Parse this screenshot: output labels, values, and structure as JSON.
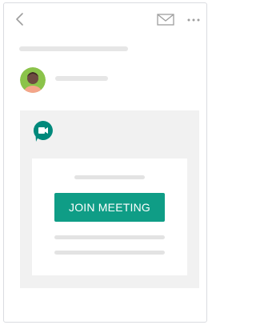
{
  "toolbar": {
    "back_icon": "chevron-left-icon",
    "mail_icon": "envelope-icon",
    "more_icon": "more-horizontal-icon"
  },
  "sender": {
    "avatar_icon": "person-avatar"
  },
  "event": {
    "logo_icon": "google-meet-icon",
    "join_button_label": "JOIN MEETING"
  },
  "colors": {
    "join_button": "#0f9d86",
    "meet_logo": "#00897b",
    "avatar_background": "#8bc34a",
    "card_background": "#f1f1f1",
    "placeholder_line": "#e6e6e6",
    "icon_gray": "#9e9e9e"
  }
}
